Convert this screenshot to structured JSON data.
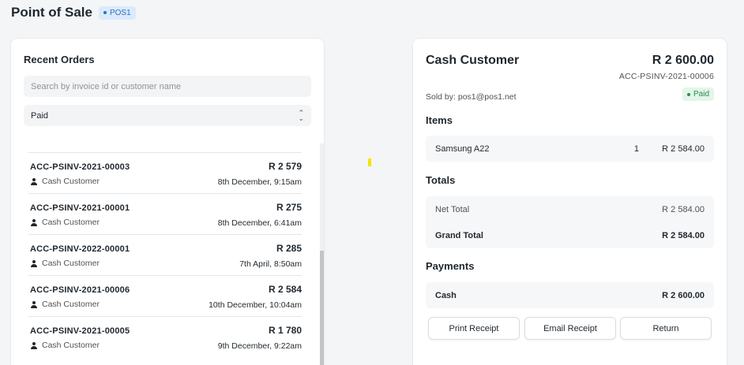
{
  "header": {
    "title": "Point of Sale",
    "pos_badge": "POS1"
  },
  "recent_orders": {
    "title": "Recent Orders",
    "search_placeholder": "Search by invoice id or customer name",
    "status_filter": "Paid",
    "orders": [
      {
        "id": "ACC-PSINV-2021-00003",
        "customer": "Cash Customer",
        "amount": "R 2 579",
        "date": "8th December, 9:15am"
      },
      {
        "id": "ACC-PSINV-2021-00001",
        "customer": "Cash Customer",
        "amount": "R 275",
        "date": "8th December, 6:41am"
      },
      {
        "id": "ACC-PSINV-2022-00001",
        "customer": "Cash Customer",
        "amount": "R 285",
        "date": "7th April, 8:50am"
      },
      {
        "id": "ACC-PSINV-2021-00006",
        "customer": "Cash Customer",
        "amount": "R 2 584",
        "date": "10th December, 10:04am"
      },
      {
        "id": "ACC-PSINV-2021-00005",
        "customer": "Cash Customer",
        "amount": "R 1 780",
        "date": "9th December, 9:22am"
      }
    ]
  },
  "invoice": {
    "customer": "Cash Customer",
    "grand_amount": "R 2 600.00",
    "invoice_no": "ACC-PSINV-2021-00006",
    "sold_by": "Sold by: pos1@pos1.net",
    "status": "Paid",
    "items_title": "Items",
    "items": [
      {
        "name": "Samsung A22",
        "qty": "1",
        "amount": "R 2 584.00"
      }
    ],
    "totals_title": "Totals",
    "net_total_label": "Net Total",
    "net_total": "R 2 584.00",
    "grand_total_label": "Grand Total",
    "grand_total": "R 2 584.00",
    "payments_title": "Payments",
    "payment_mode": "Cash",
    "payment_amount": "R 2 600.00",
    "buttons": {
      "print": "Print Receipt",
      "email": "Email Receipt",
      "return": "Return"
    }
  },
  "colors": {
    "paid_bg": "#e4f5e9",
    "paid_text": "#2a8b4c",
    "pos_badge_bg": "#dbeafe",
    "pos_badge_text": "#2f6fb8"
  }
}
